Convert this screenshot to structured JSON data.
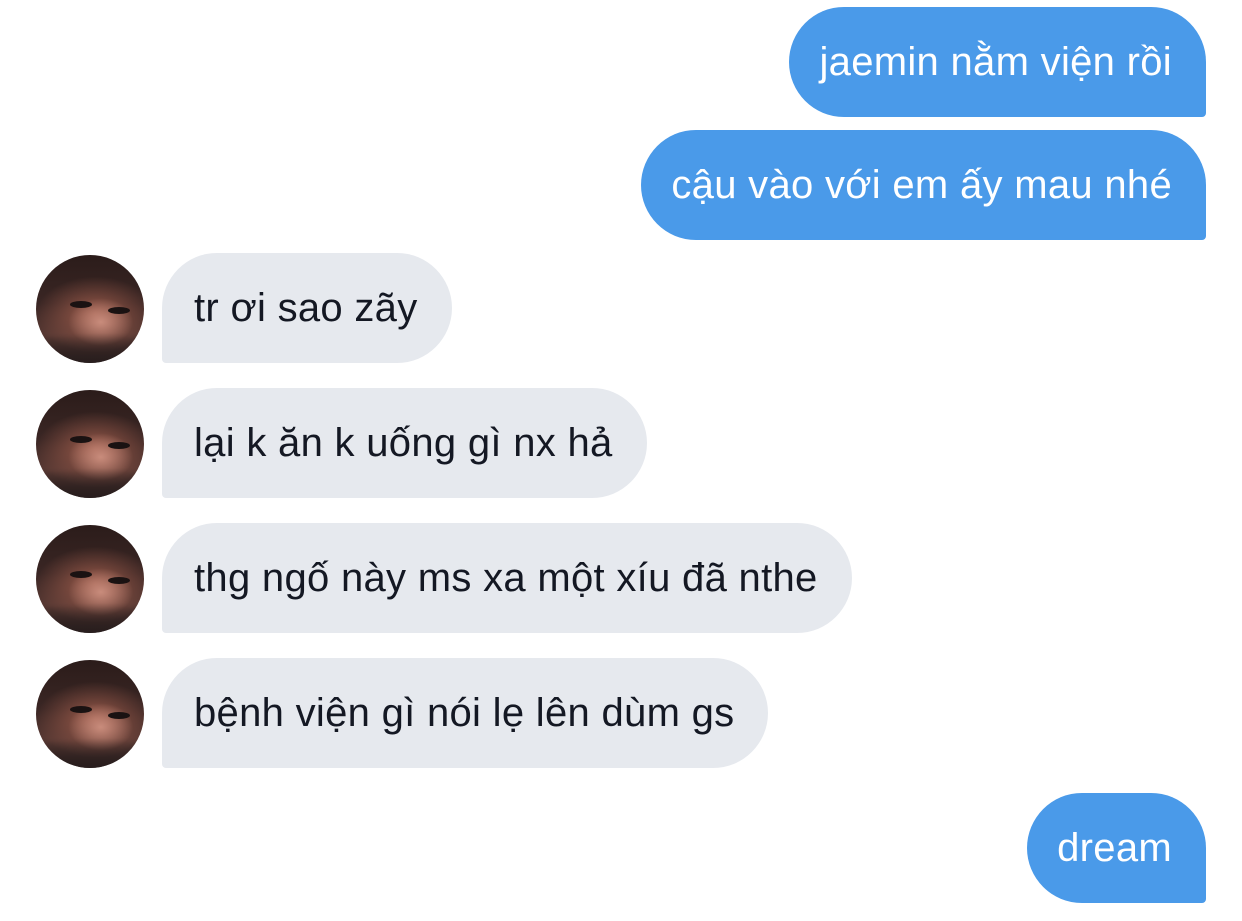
{
  "messages": [
    {
      "direction": "sent",
      "text": "jaemin nằm viện rồi"
    },
    {
      "direction": "sent",
      "text": "cậu vào với em ấy mau nhé"
    },
    {
      "direction": "received",
      "text": "tr ơi sao zãy"
    },
    {
      "direction": "received",
      "text": "lại k ăn k uống gì nx hả"
    },
    {
      "direction": "received",
      "text": "thg ngố này ms xa một xíu đã nthe"
    },
    {
      "direction": "received",
      "text": "bệnh viện gì nói lẹ lên dùm gs"
    },
    {
      "direction": "sent",
      "text": "dream"
    }
  ],
  "colors": {
    "sent_bubble": "#4a9ae9",
    "received_bubble": "#e6e9ee",
    "received_text": "#141823",
    "background": "#ffffff"
  },
  "icons": {
    "avatar": "contact-avatar-photo"
  }
}
